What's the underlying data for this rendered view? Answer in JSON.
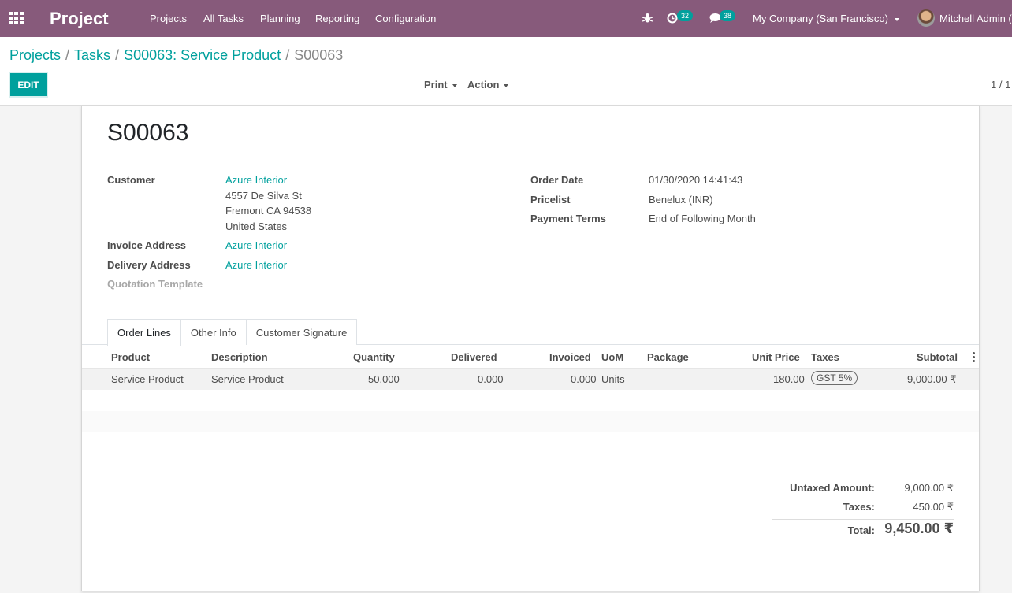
{
  "navbar": {
    "brand": "Project",
    "menu": [
      "Projects",
      "All Tasks",
      "Planning",
      "Reporting",
      "Configuration"
    ],
    "activity_count": "32",
    "message_count": "38",
    "company": "My Company (San Francisco)",
    "user": "Mitchell Admin ("
  },
  "breadcrumb": {
    "items": [
      "Projects",
      "Tasks",
      "S00063: Service Product"
    ],
    "current": "S00063"
  },
  "controls": {
    "edit_label": "EDIT",
    "print_label": "Print",
    "action_label": "Action",
    "pager": "1 / 1"
  },
  "form": {
    "title": "S00063",
    "customer_label": "Customer",
    "customer": "Azure Interior",
    "address_lines": [
      "4557 De Silva St",
      "Fremont CA 94538",
      "United States"
    ],
    "invoice_address_label": "Invoice Address",
    "invoice_address": "Azure Interior",
    "delivery_address_label": "Delivery Address",
    "delivery_address": "Azure Interior",
    "quotation_template_label": "Quotation Template",
    "order_date_label": "Order Date",
    "order_date": "01/30/2020 14:41:43",
    "pricelist_label": "Pricelist",
    "pricelist": "Benelux (INR)",
    "payment_terms_label": "Payment Terms",
    "payment_terms": "End of Following Month"
  },
  "tabs": [
    "Order Lines",
    "Other Info",
    "Customer Signature"
  ],
  "table": {
    "headers": [
      "Product",
      "Description",
      "Quantity",
      "Delivered",
      "Invoiced",
      "UoM",
      "Package",
      "Unit Price",
      "Taxes",
      "Subtotal"
    ],
    "rows": [
      {
        "product": "Service Product",
        "description": "Service Product",
        "quantity": "50.000",
        "delivered": "0.000",
        "invoiced": "0.000",
        "uom": "Units",
        "package": "",
        "unit_price": "180.00",
        "taxes": "GST 5%",
        "subtotal": "9,000.00 ₹"
      }
    ]
  },
  "totals": {
    "untaxed_label": "Untaxed Amount:",
    "untaxed": "9,000.00 ₹",
    "taxes_label": "Taxes:",
    "taxes": "450.00 ₹",
    "total_label": "Total:",
    "total": "9,450.00 ₹"
  },
  "colors": {
    "navbar": "#875a7b",
    "accent": "#00a09d"
  }
}
